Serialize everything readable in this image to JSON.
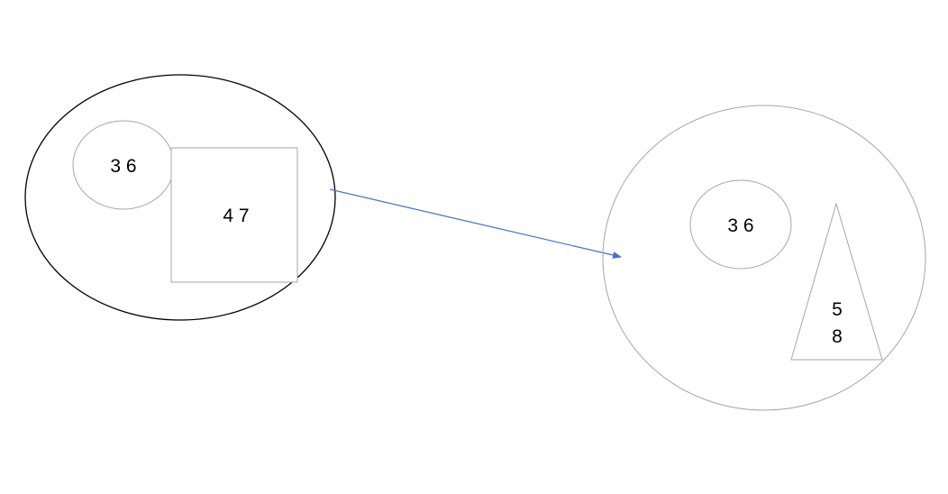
{
  "diagram": {
    "left_group": {
      "circle_label": "3 6",
      "square_label": "4 7"
    },
    "right_group": {
      "circle_label": "3 6",
      "triangle_label_line1": "5",
      "triangle_label_line2": "8"
    },
    "colors": {
      "outer_left_stroke": "#000000",
      "shape_stroke": "#a6a6a6",
      "arrow": "#4472c4",
      "text": "#000000"
    }
  }
}
